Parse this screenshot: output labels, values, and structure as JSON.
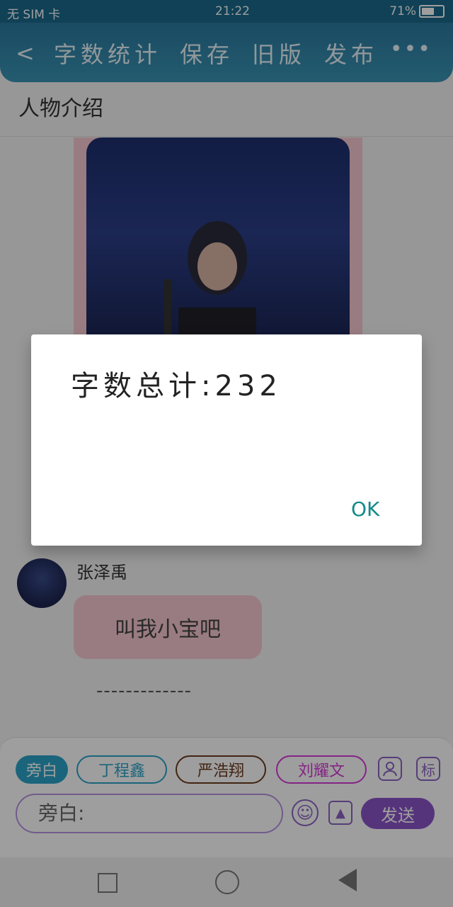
{
  "status_bar": {
    "carrier": "无 SIM 卡",
    "time": "21:22",
    "battery": "71%",
    "battery_level": 0.71
  },
  "header": {
    "back_label": "<",
    "actions": [
      "字数统计",
      "保存",
      "旧版",
      "发布"
    ],
    "more_label": "•••"
  },
  "section_title": "人物介绍",
  "chat": {
    "name": "张泽禹",
    "message": "叫我小宝吧",
    "separator": "-------------"
  },
  "composer": {
    "chips": [
      "旁白",
      "丁程鑫",
      "严浩翔",
      "刘耀文"
    ],
    "profile_icon": "person-icon",
    "tag_label": "标",
    "input_placeholder": "旁白:",
    "send_label": "发送"
  },
  "dialog": {
    "message": "字数总计:232",
    "ok_label": "OK"
  },
  "colors": {
    "header": "#2b7aa0",
    "pink": "#f7c9d0",
    "purple": "#8b55c9",
    "teal": "#138a8a"
  }
}
